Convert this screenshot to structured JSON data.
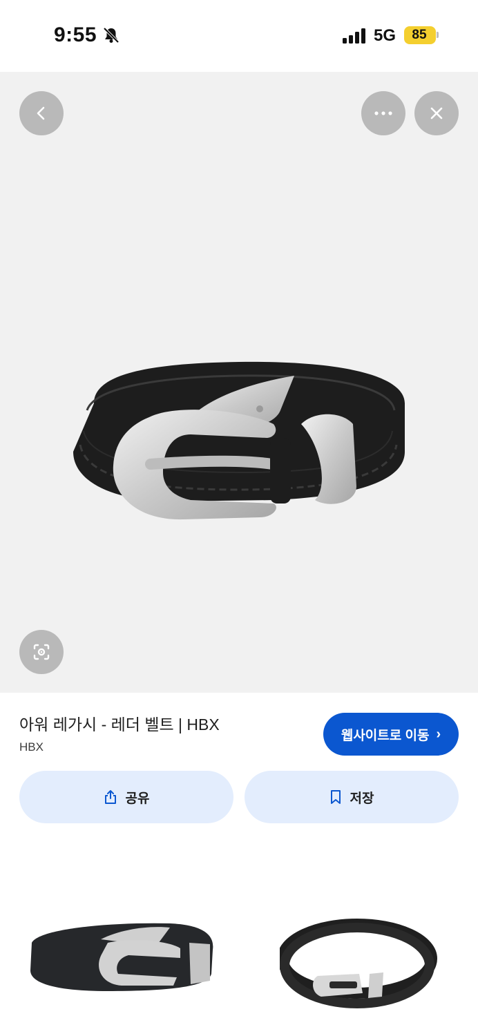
{
  "status": {
    "time": "9:55",
    "network": "5G",
    "battery": "85"
  },
  "viewer": {
    "back_icon": "chevron-left-icon",
    "more_icon": "more-horizontal-icon",
    "close_icon": "close-icon",
    "lens_icon": "lens-search-icon"
  },
  "product": {
    "title": "아워 레가시 - 레더 벨트 | HBX",
    "source": "HBX",
    "visit_label": "웹사이트로 이동",
    "visit_chevron": "›"
  },
  "actions": {
    "share_label": "공유",
    "save_label": "저장"
  },
  "colors": {
    "accent": "#0b57d0",
    "action_bg": "#e3edfd",
    "viewer_bg": "#f1f1f1",
    "battery": "#f4cf2f"
  }
}
